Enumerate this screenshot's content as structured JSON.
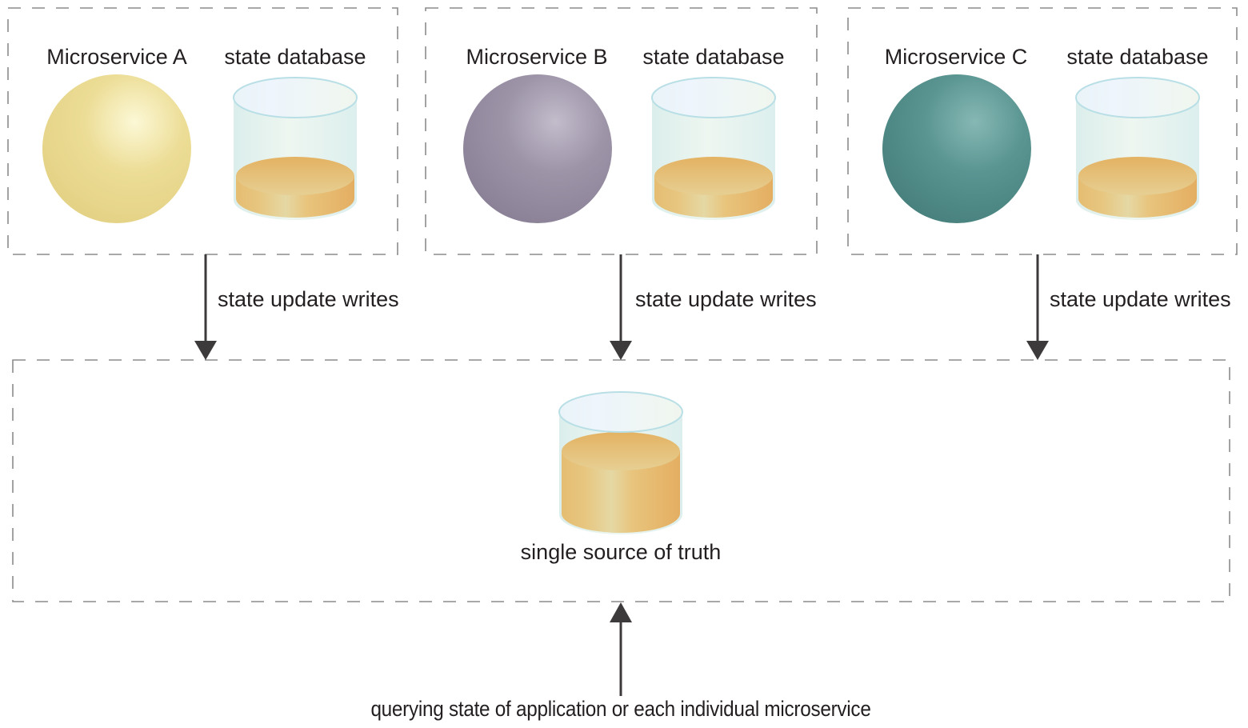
{
  "services": [
    {
      "id": "a",
      "name": "Microservice A",
      "db_label": "state database",
      "sphere_color": "#e8d68a",
      "sphere_highlight": "#fcf8d6",
      "arrow_label": "state update writes"
    },
    {
      "id": "b",
      "name": "Microservice B",
      "db_label": "state database",
      "sphere_color": "#8f8599",
      "sphere_highlight": "#c2bccb",
      "arrow_label": "state update writes"
    },
    {
      "id": "c",
      "name": "Microservice C",
      "db_label": "state database",
      "sphere_color": "#4a8481",
      "sphere_highlight": "#86b8b4",
      "arrow_label": "state update writes"
    }
  ],
  "central": {
    "label": "single source of truth"
  },
  "query": {
    "label": "querying state of application or each individual microservice"
  },
  "colors": {
    "dash": "#8c8c8c",
    "arrow": "#3d3a3b",
    "fluid": "#e6b46a",
    "fluid_light": "#e5d8a4",
    "glass": "#e1f0ef",
    "glass_rim": "#b9dfe6"
  }
}
